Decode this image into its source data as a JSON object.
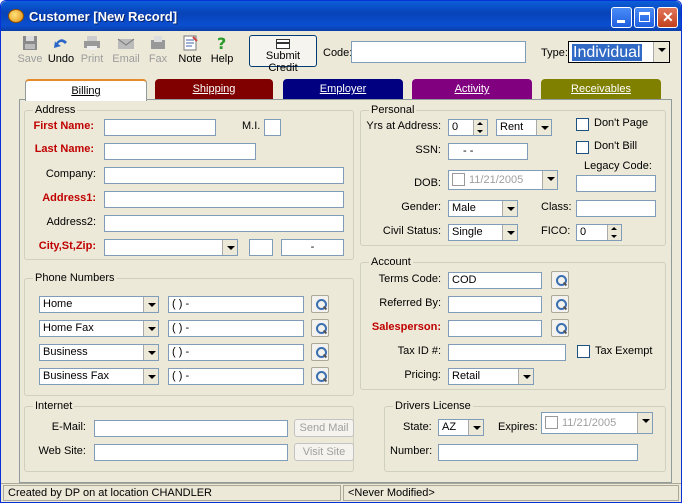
{
  "window": {
    "title": "Customer [New Record]"
  },
  "toolbar": {
    "save": "Save",
    "undo": "Undo",
    "print": "Print",
    "email": "Email",
    "fax": "Fax",
    "note": "Note",
    "help": "Help",
    "submit_credit": "Submit Credit",
    "code_label": "Code:",
    "code_value": "",
    "type_label": "Type:",
    "type_value": "Individual"
  },
  "tabs": [
    {
      "label": "Billing",
      "color": "#ffffff"
    },
    {
      "label": "Shipping",
      "color": "#800000"
    },
    {
      "label": "Employer",
      "color": "#000080"
    },
    {
      "label": "Activity",
      "color": "#800080"
    },
    {
      "label": "Receivables",
      "color": "#808000"
    }
  ],
  "address": {
    "title": "Address",
    "first_name": "First Name:",
    "mi": "M.I.",
    "last_name": "Last Name:",
    "company": "Company:",
    "address1": "Address1:",
    "address2": "Address2:",
    "city_st_zip": "City,St,Zip:",
    "zip_value": "-"
  },
  "phones": {
    "title": "Phone Numbers",
    "rows": [
      {
        "type": "Home",
        "value": "(   )   -"
      },
      {
        "type": "Home Fax",
        "value": "(   )   -"
      },
      {
        "type": "Business",
        "value": "(   )   -"
      },
      {
        "type": "Business Fax",
        "value": "(   )   -"
      }
    ]
  },
  "internet": {
    "title": "Internet",
    "email": "E-Mail:",
    "website": "Web Site:",
    "send_mail": "Send Mail",
    "visit_site": "Visit Site"
  },
  "personal": {
    "title": "Personal",
    "yrs_at_address": "Yrs at Address:",
    "yrs_value": "0",
    "rent_value": "Rent",
    "dont_page": "Don't Page",
    "dont_bill": "Don't Bill",
    "ssn": "SSN:",
    "ssn_value": "-   -",
    "legacy_code": "Legacy Code:",
    "dob": "DOB:",
    "dob_value": "11/21/2005",
    "gender": "Gender:",
    "gender_value": "Male",
    "class": "Class:",
    "civil_status": "Civil Status:",
    "civil_value": "Single",
    "fico": "FICO:",
    "fico_value": "0"
  },
  "account": {
    "title": "Account",
    "terms_code": "Terms Code:",
    "terms_value": "COD",
    "referred_by": "Referred By:",
    "salesperson": "Salesperson:",
    "tax_id": "Tax ID #:",
    "tax_exempt": "Tax Exempt",
    "pricing": "Pricing:",
    "pricing_value": "Retail"
  },
  "license": {
    "title": "Drivers License",
    "state": "State:",
    "state_value": "AZ",
    "expires": "Expires:",
    "expires_value": "11/21/2005",
    "number": "Number:"
  },
  "status": {
    "created": "Created by DP on  at location CHANDLER",
    "modified": "<Never Modified>"
  }
}
